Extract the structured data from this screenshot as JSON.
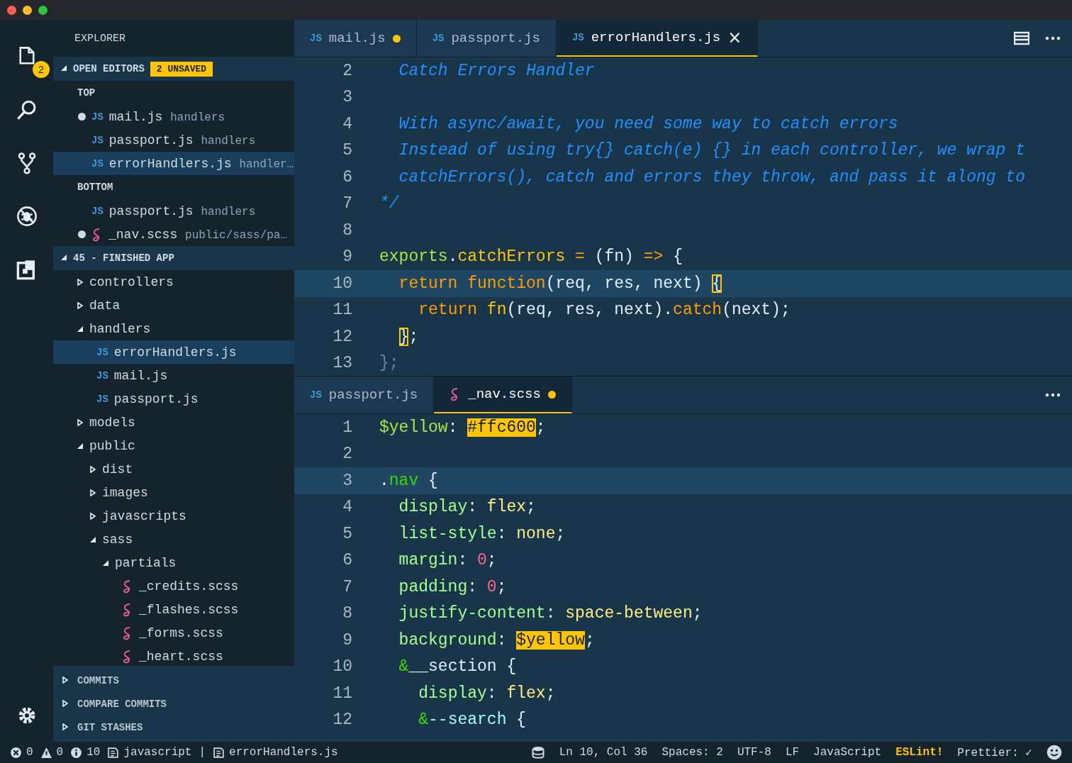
{
  "activity_bar": {
    "items": [
      {
        "kind": "files",
        "badge": "2"
      },
      {
        "kind": "search"
      },
      {
        "kind": "source-control"
      },
      {
        "kind": "debug"
      },
      {
        "kind": "extensions"
      }
    ],
    "bottom_items": [
      {
        "kind": "settings"
      }
    ]
  },
  "sidebar": {
    "title": "EXPLORER",
    "open_editors": {
      "label": "OPEN EDITORS",
      "expanded": true,
      "badge": "2 UNSAVED",
      "groups": [
        {
          "label": "TOP",
          "files": [
            {
              "name": "mail.js",
              "dir": "handlers",
              "kind": "js",
              "icon": "JS",
              "dirty": true,
              "selected": false
            },
            {
              "name": "passport.js",
              "dir": "handlers",
              "kind": "js",
              "icon": "JS",
              "dirty": false,
              "selected": false
            },
            {
              "name": "errorHandlers.js",
              "dir": "handler…",
              "kind": "js",
              "icon": "JS",
              "dirty": false,
              "selected": true
            }
          ]
        },
        {
          "label": "BOTTOM",
          "files": [
            {
              "name": "passport.js",
              "dir": "handlers",
              "kind": "js",
              "icon": "JS",
              "dirty": false,
              "selected": false
            },
            {
              "name": "_nav.scss",
              "dir": "public/sass/pa…",
              "kind": "scss",
              "dirty": true,
              "selected": false
            }
          ]
        }
      ]
    },
    "folder": {
      "label": "45 - FINISHED APP",
      "expanded": true,
      "children": [
        {
          "name": "controllers",
          "kind": "folder",
          "expanded": false,
          "selected": false
        },
        {
          "name": "data",
          "kind": "folder",
          "expanded": false,
          "selected": false
        },
        {
          "name": "handlers",
          "kind": "folder",
          "expanded": true,
          "selected": false,
          "children": [
            {
              "name": "errorHandlers.js",
              "kind": "js",
              "icon": "JS",
              "selected": true
            },
            {
              "name": "mail.js",
              "kind": "js",
              "icon": "JS",
              "selected": false
            },
            {
              "name": "passport.js",
              "kind": "js",
              "icon": "JS",
              "selected": false
            }
          ]
        },
        {
          "name": "models",
          "kind": "folder",
          "expanded": false,
          "selected": false
        },
        {
          "name": "public",
          "kind": "folder",
          "expanded": true,
          "selected": false,
          "children": [
            {
              "name": "dist",
              "kind": "folder",
              "expanded": false,
              "selected": false
            },
            {
              "name": "images",
              "kind": "folder",
              "expanded": false,
              "selected": false
            },
            {
              "name": "javascripts",
              "kind": "folder",
              "expanded": false,
              "selected": false
            },
            {
              "name": "sass",
              "kind": "folder",
              "expanded": true,
              "selected": false,
              "children": [
                {
                  "name": "partials",
                  "kind": "folder",
                  "expanded": true,
                  "selected": false,
                  "children": [
                    {
                      "name": "_credits.scss",
                      "kind": "scss",
                      "selected": false
                    },
                    {
                      "name": "_flashes.scss",
                      "kind": "scss",
                      "selected": false
                    },
                    {
                      "name": "_forms.scss",
                      "kind": "scss",
                      "selected": false
                    },
                    {
                      "name": "_heart.scss",
                      "kind": "scss",
                      "selected": false
                    }
                  ]
                }
              ]
            }
          ]
        }
      ]
    },
    "panels": [
      {
        "label": "COMMITS",
        "expanded": false
      },
      {
        "label": "COMPARE COMMITS",
        "expanded": false
      },
      {
        "label": "GIT STASHES",
        "expanded": false
      }
    ]
  },
  "editor_groups": [
    {
      "tabs": [
        {
          "name": "mail.js",
          "kind": "js",
          "icon": "JS",
          "dirty": true,
          "selected": false
        },
        {
          "name": "passport.js",
          "kind": "js",
          "icon": "JS",
          "dirty": false,
          "selected": false
        },
        {
          "name": "errorHandlers.js",
          "kind": "js",
          "icon": "JS",
          "dirty": false,
          "selected": true,
          "close": "×"
        }
      ],
      "actions": [
        {
          "kind": "split"
        },
        {
          "kind": "more"
        }
      ],
      "lines": [
        {
          "n": "2",
          "current": false,
          "tokens": [
            {
              "text": "  Catch Errors Handler",
              "kind": "comment"
            }
          ]
        },
        {
          "n": "3",
          "current": false
        },
        {
          "n": "4",
          "current": false,
          "tokens": [
            {
              "text": "  With async/await, you need some way to catch errors",
              "kind": "comment"
            }
          ]
        },
        {
          "n": "5",
          "current": false,
          "tokens": [
            {
              "text": "  Instead of using try{} catch(e) {} in each controller, we wrap t",
              "kind": "comment"
            }
          ]
        },
        {
          "n": "6",
          "current": false,
          "tokens": [
            {
              "text": "  catchErrors(), catch and errors they throw, and pass it along to",
              "kind": "comment"
            }
          ]
        },
        {
          "n": "7",
          "current": false,
          "tokens": [
            {
              "text": "*/",
              "kind": "comment"
            }
          ]
        },
        {
          "n": "8",
          "current": false
        },
        {
          "n": "9",
          "current": false,
          "tokens": [
            {
              "text": "exports",
              "kind": "var"
            },
            {
              "text": ".",
              "kind": "punc"
            },
            {
              "text": "catchErrors",
              "kind": "prop"
            },
            {
              "text": " = ",
              "kind": "op"
            },
            {
              "text": "(fn)",
              "kind": "punc"
            },
            {
              "text": " => ",
              "kind": "op"
            },
            {
              "text": "{",
              "kind": "punc"
            }
          ]
        },
        {
          "n": "10",
          "current": true,
          "tokens": [
            {
              "text": "  return",
              "kind": "keyword"
            },
            {
              "text": " function",
              "kind": "keyword"
            },
            {
              "text": "(req, res, next) ",
              "kind": "punc"
            },
            {
              "text": "{",
              "kind": "match"
            }
          ]
        },
        {
          "n": "11",
          "current": false,
          "tokens": [
            {
              "text": "    return",
              "kind": "keyword"
            },
            {
              "text": " fn",
              "kind": "prop"
            },
            {
              "text": "(req, res, next).",
              "kind": "punc"
            },
            {
              "text": "catch",
              "kind": "keyword"
            },
            {
              "text": "(next);",
              "kind": "punc"
            }
          ]
        },
        {
          "n": "12",
          "current": false,
          "tokens": [
            {
              "text": "  }",
              "kind": "match"
            },
            {
              "text": ";",
              "kind": "punc"
            }
          ]
        },
        {
          "n": "13",
          "current": false,
          "tokens": [
            {
              "text": "};",
              "kind": "dim"
            }
          ]
        }
      ]
    },
    {
      "tabs": [
        {
          "name": "passport.js",
          "kind": "js",
          "icon": "JS",
          "dirty": false,
          "selected": false
        },
        {
          "name": "_nav.scss",
          "kind": "scss",
          "dirty": true,
          "selected": true
        }
      ],
      "actions": [
        {
          "kind": "more"
        }
      ],
      "lines": [
        {
          "n": "1",
          "current": false,
          "tokens": [
            {
              "text": "$yellow",
              "kind": "var"
            },
            {
              "text": ": ",
              "kind": "punc"
            },
            {
              "text": "#ffc600",
              "kind": "swatch"
            },
            {
              "text": ";",
              "kind": "punc"
            }
          ]
        },
        {
          "n": "2",
          "current": false
        },
        {
          "n": "3",
          "current": true,
          "tokens": [
            {
              "text": ".",
              "kind": "punc"
            },
            {
              "text": "nav",
              "kind": "selector"
            },
            {
              "text": " {",
              "kind": "punc"
            }
          ]
        },
        {
          "n": "4",
          "current": false,
          "tokens": [
            {
              "text": "  display",
              "kind": "cssprop"
            },
            {
              "text": ": ",
              "kind": "punc"
            },
            {
              "text": "flex",
              "kind": "value"
            },
            {
              "text": ";",
              "kind": "punc"
            }
          ]
        },
        {
          "n": "5",
          "current": false,
          "tokens": [
            {
              "text": "  list-style",
              "kind": "cssprop"
            },
            {
              "text": ": ",
              "kind": "punc"
            },
            {
              "text": "none",
              "kind": "value"
            },
            {
              "text": ";",
              "kind": "punc"
            }
          ]
        },
        {
          "n": "6",
          "current": false,
          "tokens": [
            {
              "text": "  margin",
              "kind": "cssprop"
            },
            {
              "text": ": ",
              "kind": "punc"
            },
            {
              "text": "0",
              "kind": "num"
            },
            {
              "text": ";",
              "kind": "punc"
            }
          ]
        },
        {
          "n": "7",
          "current": false,
          "tokens": [
            {
              "text": "  padding",
              "kind": "cssprop"
            },
            {
              "text": ": ",
              "kind": "punc"
            },
            {
              "text": "0",
              "kind": "num"
            },
            {
              "text": ";",
              "kind": "punc"
            }
          ]
        },
        {
          "n": "8",
          "current": false,
          "tokens": [
            {
              "text": "  justify-content",
              "kind": "cssprop"
            },
            {
              "text": ": ",
              "kind": "punc"
            },
            {
              "text": "space-between",
              "kind": "value"
            },
            {
              "text": ";",
              "kind": "punc"
            }
          ]
        },
        {
          "n": "9",
          "current": false,
          "tokens": [
            {
              "text": "  background",
              "kind": "cssprop"
            },
            {
              "text": ": ",
              "kind": "punc"
            },
            {
              "text": "$yellow",
              "kind": "swatch"
            },
            {
              "text": ";",
              "kind": "punc"
            }
          ]
        },
        {
          "n": "10",
          "current": false,
          "tokens": [
            {
              "text": "  &",
              "kind": "selector"
            },
            {
              "text": "__section {",
              "kind": "punc"
            }
          ]
        },
        {
          "n": "11",
          "current": false,
          "tokens": [
            {
              "text": "    display",
              "kind": "cssprop"
            },
            {
              "text": ": ",
              "kind": "punc"
            },
            {
              "text": "flex",
              "kind": "value"
            },
            {
              "text": ";",
              "kind": "punc"
            }
          ]
        },
        {
          "n": "12",
          "current": false,
          "tokens": [
            {
              "text": "    &",
              "kind": "selector"
            },
            {
              "text": "--search",
              "kind": "cyan"
            },
            {
              "text": " {",
              "kind": "punc"
            }
          ]
        }
      ]
    }
  ],
  "status_bar": {
    "left": [
      {
        "kind": "errors",
        "text": "0"
      },
      {
        "kind": "warnings",
        "text": "0"
      },
      {
        "kind": "info",
        "text": "10"
      },
      {
        "kind": "repo",
        "text": "javascript"
      },
      {
        "kind": "separator",
        "text": "|"
      },
      {
        "kind": "file",
        "text": "errorHandlers.js"
      }
    ],
    "right": [
      {
        "kind": "db"
      },
      {
        "kind": "text",
        "text": "Ln 10, Col 36"
      },
      {
        "kind": "text",
        "text": "Spaces: 2"
      },
      {
        "kind": "text",
        "text": "UTF-8"
      },
      {
        "kind": "text",
        "text": "LF"
      },
      {
        "kind": "text",
        "text": "JavaScript"
      },
      {
        "kind": "eslint",
        "text": "ESLint!"
      },
      {
        "kind": "text",
        "text": "Prettier: ✓"
      },
      {
        "kind": "feedback"
      }
    ]
  }
}
